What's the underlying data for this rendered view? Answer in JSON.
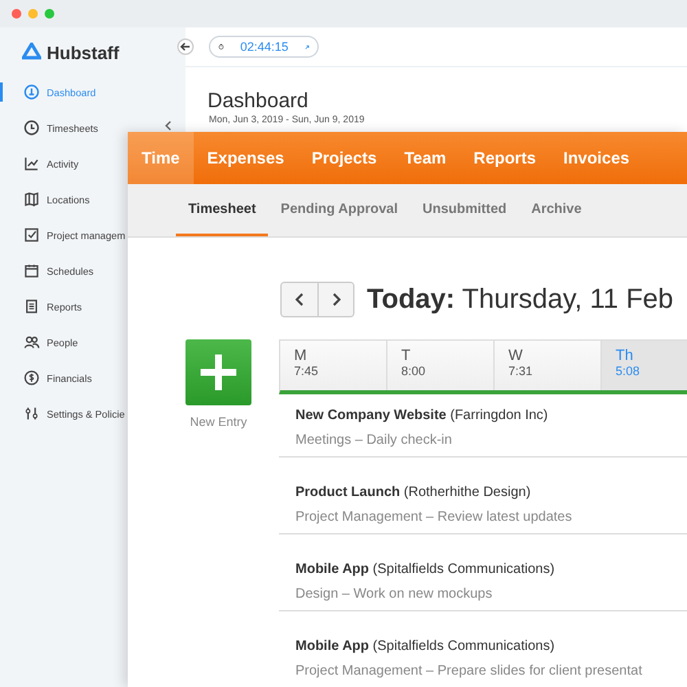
{
  "sidebar": {
    "logo": "Hubstaff",
    "items": [
      {
        "label": "Dashboard",
        "selected": true,
        "expandable": false
      },
      {
        "label": "Timesheets",
        "selected": false,
        "expandable": true
      },
      {
        "label": "Activity",
        "selected": false,
        "expandable": false
      },
      {
        "label": "Locations",
        "selected": false,
        "expandable": false
      },
      {
        "label": "Project managem",
        "selected": false,
        "expandable": false
      },
      {
        "label": "Schedules",
        "selected": false,
        "expandable": false
      },
      {
        "label": "Reports",
        "selected": false,
        "expandable": false
      },
      {
        "label": "People",
        "selected": false,
        "expandable": false
      },
      {
        "label": "Financials",
        "selected": false,
        "expandable": false
      },
      {
        "label": "Settings & Policie",
        "selected": false,
        "expandable": false
      }
    ]
  },
  "topbar": {
    "timer": "02:44:15"
  },
  "header": {
    "title": "Dashboard",
    "date_range": "Mon, Jun 3, 2019 - Sun, Jun 9, 2019"
  },
  "overlay": {
    "main_tabs": [
      {
        "label": "Time",
        "selected": true
      },
      {
        "label": "Expenses",
        "selected": false
      },
      {
        "label": "Projects",
        "selected": false
      },
      {
        "label": "Team",
        "selected": false
      },
      {
        "label": "Reports",
        "selected": false
      },
      {
        "label": "Invoices",
        "selected": false
      }
    ],
    "sub_tabs": [
      {
        "label": "Timesheet",
        "selected": true
      },
      {
        "label": "Pending Approval",
        "selected": false
      },
      {
        "label": "Unsubmitted",
        "selected": false
      },
      {
        "label": "Archive",
        "selected": false
      }
    ],
    "date_title": "**Today:** Thursday, 11 Feb",
    "new_entry": "New Entry",
    "days": [
      {
        "day": "M",
        "time": "7:45",
        "selected": false
      },
      {
        "day": "T",
        "time": "8:00",
        "selected": false
      },
      {
        "day": "W",
        "time": "7:31",
        "selected": false
      },
      {
        "day": "Th",
        "time": "5:08",
        "selected": true
      }
    ],
    "entries": [
      {
        "title": "**New Company Website**  (Farringdon Inc)",
        "detail": "Meetings  –  Daily check-in"
      },
      {
        "title": "**Product Launch**  (Rotherhithe Design)",
        "detail": "Project Management  –  Review latest updates"
      },
      {
        "title": "**Mobile App**  (Spitalfields Communications)",
        "detail": "Design  –  Work on new mockups"
      },
      {
        "title": "**Mobile App**  (Spitalfields Communications)",
        "detail": "Project Management  –  Prepare slides for client presentat"
      }
    ]
  }
}
